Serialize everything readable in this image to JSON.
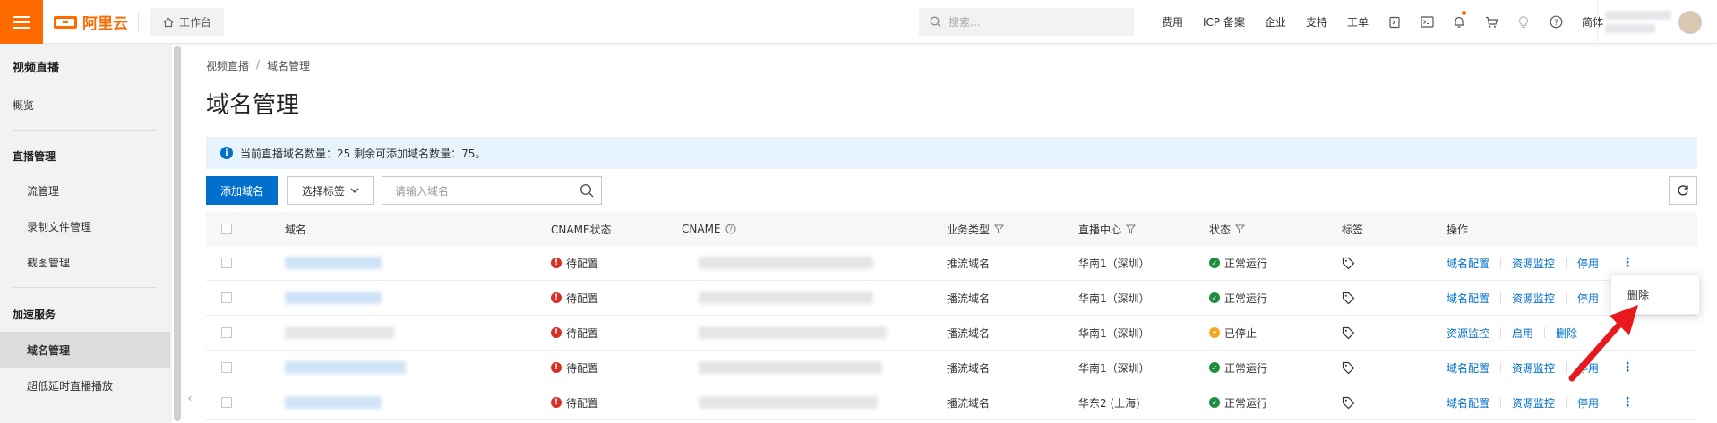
{
  "topbar": {
    "brand": "阿里云",
    "workbench": "工作台",
    "search_placeholder": "搜索...",
    "links": [
      "费用",
      "ICP 备案",
      "企业",
      "支持",
      "工单"
    ],
    "language": "简体"
  },
  "sidebar": {
    "title": "视频直播",
    "overview": "概览",
    "groups": [
      {
        "label": "直播管理",
        "items": [
          "流管理",
          "录制文件管理",
          "截图管理"
        ]
      },
      {
        "label": "加速服务",
        "items": [
          "域名管理",
          "超低延时直播播放"
        ]
      }
    ],
    "active": "域名管理"
  },
  "breadcrumb": {
    "root": "视频直播",
    "sep": "/",
    "current": "域名管理"
  },
  "page_title": "域名管理",
  "notice": "当前直播域名数量：25 剩余可添加域名数量：75。",
  "toolbar": {
    "add_domain": "添加域名",
    "select_tag": "选择标签",
    "domain_placeholder": "请输入域名"
  },
  "table": {
    "headers": {
      "domain": "域名",
      "cname_status": "CNAME状态",
      "cname": "CNAME",
      "biz_type": "业务类型",
      "center": "直播中心",
      "status": "状态",
      "tags": "标签",
      "ops": "操作"
    },
    "rows": [
      {
        "cname_status": "待配置",
        "biz_type": "推流域名",
        "center": "华南1（深圳）",
        "status": "正常运行",
        "status_kind": "ok",
        "ops": [
          "域名配置",
          "资源监控",
          "停用"
        ]
      },
      {
        "cname_status": "待配置",
        "biz_type": "播流域名",
        "center": "华南1（深圳）",
        "status": "正常运行",
        "status_kind": "ok",
        "ops": [
          "域名配置",
          "资源监控",
          "停用"
        ]
      },
      {
        "cname_status": "待配置",
        "biz_type": "播流域名",
        "center": "华南1（深圳）",
        "status": "已停止",
        "status_kind": "stopped",
        "ops": [
          "资源监控",
          "启用",
          "删除"
        ]
      },
      {
        "cname_status": "待配置",
        "biz_type": "播流域名",
        "center": "华南1（深圳）",
        "status": "正常运行",
        "status_kind": "ok",
        "ops": [
          "域名配置",
          "资源监控",
          "停用"
        ]
      },
      {
        "cname_status": "待配置",
        "biz_type": "播流域名",
        "center": "华东2 (上海)",
        "status": "正常运行",
        "status_kind": "ok",
        "ops": [
          "域名配置",
          "资源监控",
          "停用"
        ]
      }
    ]
  },
  "popover": {
    "delete": "删除"
  },
  "colors": {
    "accent": "#ff6a00",
    "link": "#0070cc",
    "annotation_arrow": "#e8191d"
  }
}
